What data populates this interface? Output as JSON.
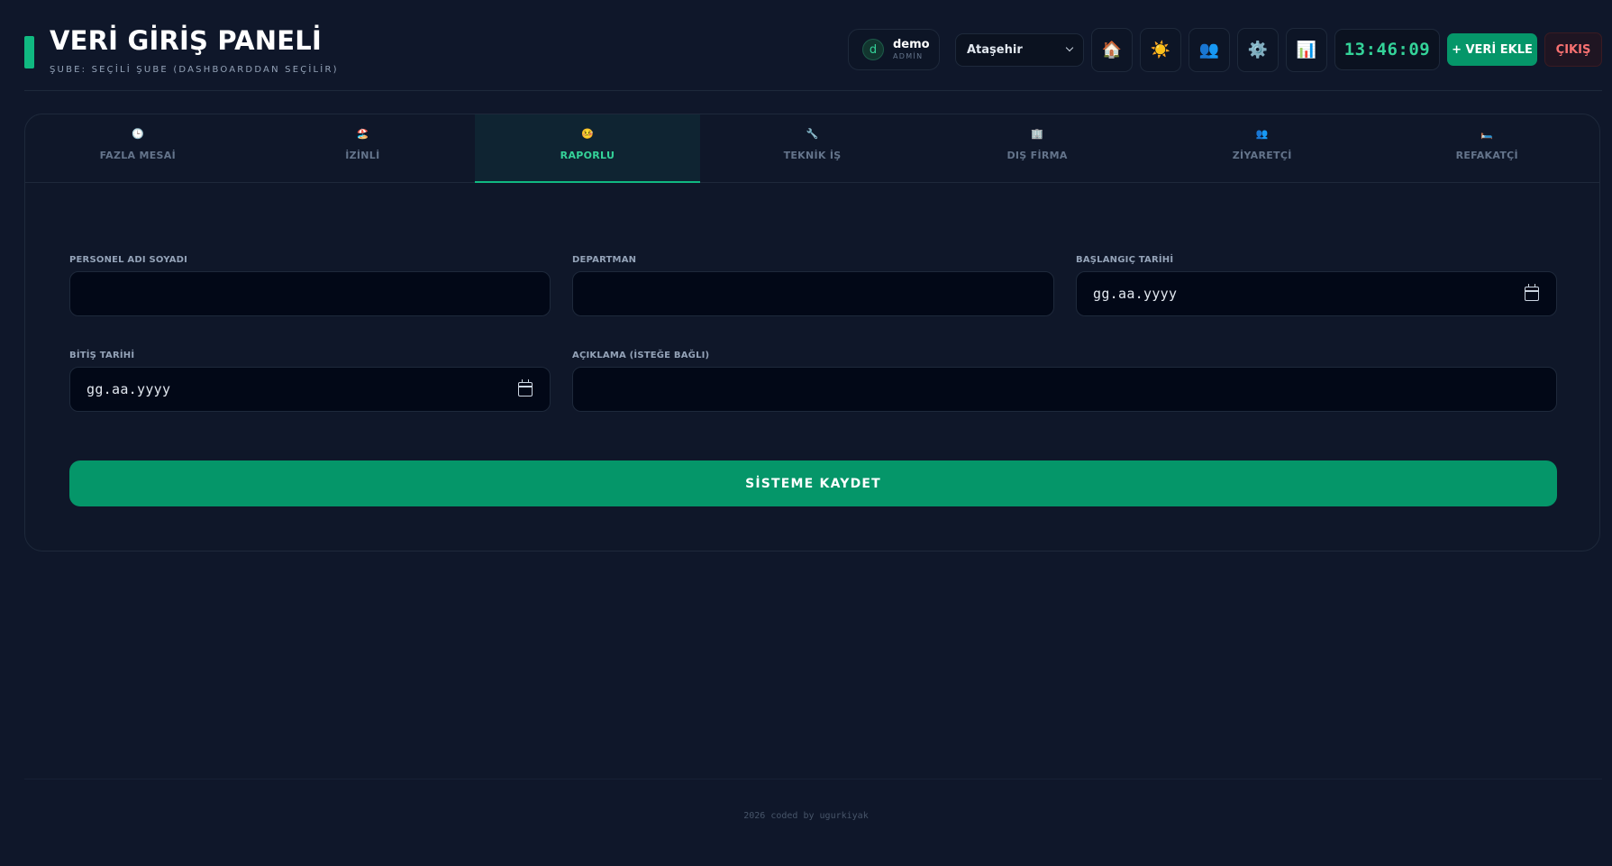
{
  "header": {
    "title": "VERİ GİRİŞ PANELİ",
    "subtitle": "ŞUBE: SEÇİLİ ŞUBE (DASHBOARDDAN SEÇİLİR)"
  },
  "user": {
    "initial": "d",
    "name": "demo",
    "role": "ADMİN"
  },
  "branch_select": {
    "selected": "Ataşehir"
  },
  "toolbar": {
    "home_icon": "🏠",
    "theme_icon": "☀️",
    "users_icon": "👥",
    "settings_icon": "⚙️",
    "stats_icon": "📊",
    "clock": "13:46:09",
    "add_label": "+ VERİ EKLE",
    "logout_label": "ÇIKIŞ"
  },
  "tabs": [
    {
      "icon": "🕒",
      "label": "FAZLA MESAİ"
    },
    {
      "icon": "🏖️",
      "label": "İZİNLİ"
    },
    {
      "icon": "🤒",
      "label": "RAPORLU"
    },
    {
      "icon": "🔧",
      "label": "TEKNİK İŞ"
    },
    {
      "icon": "🏢",
      "label": "DIŞ FİRMA"
    },
    {
      "icon": "👥",
      "label": "ZİYARETÇİ"
    },
    {
      "icon": "🛏️",
      "label": "REFAKATÇİ"
    }
  ],
  "active_tab": "RAPORLU",
  "form": {
    "personel_label": "PERSONEL ADI SOYADI",
    "departman_label": "DEPARTMAN",
    "baslangic_label": "BAŞLANGIÇ TARİHİ",
    "baslangic_placeholder": "gg.aa.yyyy",
    "bitis_label": "BİTİŞ TARİHİ",
    "bitis_placeholder": "gg.aa.yyyy",
    "aciklama_label": "AÇIKLAMA (İSTEĞE BAĞLI)",
    "save_label": "SİSTEME KAYDET"
  },
  "footer": {
    "text": "2026 coded by ugurkiyak"
  },
  "colors": {
    "background": "#0f172a",
    "accent": "#10b981",
    "primary_button": "#059669",
    "danger": "#f87171"
  }
}
